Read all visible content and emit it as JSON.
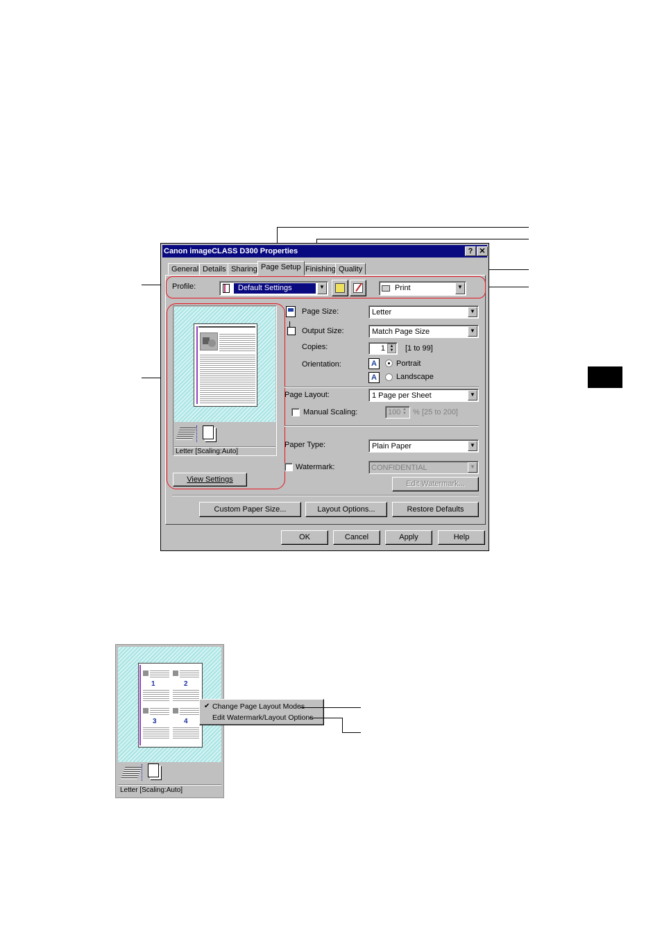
{
  "dialog": {
    "title": "Canon imageCLASS D300 Properties",
    "help_btn": "?",
    "close_btn": "✕",
    "tabs": [
      {
        "label": "General"
      },
      {
        "label": "Details"
      },
      {
        "label": "Sharing"
      },
      {
        "label": "Page Setup"
      },
      {
        "label": "Finishing"
      },
      {
        "label": "Quality"
      }
    ],
    "profile": {
      "label": "Profile:",
      "value": "Default Settings",
      "output_value": "Print"
    },
    "preview": {
      "caption": "Letter [Scaling:Auto]",
      "view_settings": "View Settings"
    },
    "page_size": {
      "label": "Page Size:",
      "value": "Letter"
    },
    "output_size": {
      "label": "Output Size:",
      "value": "Match Page Size"
    },
    "copies": {
      "label": "Copies:",
      "value": "1",
      "range": "[1 to 99]"
    },
    "orientation": {
      "label": "Orientation:",
      "portrait": "Portrait",
      "landscape": "Landscape"
    },
    "page_layout": {
      "label": "Page Layout:",
      "value": "1 Page per Sheet"
    },
    "manual_scaling": {
      "label": "Manual Scaling:",
      "value": "100",
      "unit": "%",
      "range": "[25 to 200]"
    },
    "paper_type": {
      "label": "Paper Type:",
      "value": "Plain Paper"
    },
    "watermark": {
      "label": "Watermark:",
      "value": "CONFIDENTIAL",
      "edit_btn": "Edit Watermark..."
    },
    "buttons_row": {
      "custom": "Custom Paper Size...",
      "layout": "Layout Options...",
      "restore": "Restore Defaults"
    },
    "footer": {
      "ok": "OK",
      "cancel": "Cancel",
      "apply": "Apply",
      "help": "Help"
    }
  },
  "second_preview": {
    "caption": "Letter [Scaling:Auto]",
    "page_numbers": [
      "1",
      "2",
      "3",
      "4"
    ],
    "menu": [
      {
        "label": "Change Page Layout Modes",
        "check": "✔"
      },
      {
        "label": "Edit Watermark/Layout Options",
        "check": ""
      }
    ]
  },
  "colors": {
    "highlight": "#e8141e",
    "titlebar": "#0a0a80",
    "hatch": "#a9e3e3"
  },
  "icons": [
    "page-size-icon",
    "output-size-icon",
    "portrait-icon",
    "landscape-icon",
    "printer-icon",
    "stack-icon",
    "copy-icon",
    "profile-add-icon",
    "profile-edit-icon"
  ]
}
